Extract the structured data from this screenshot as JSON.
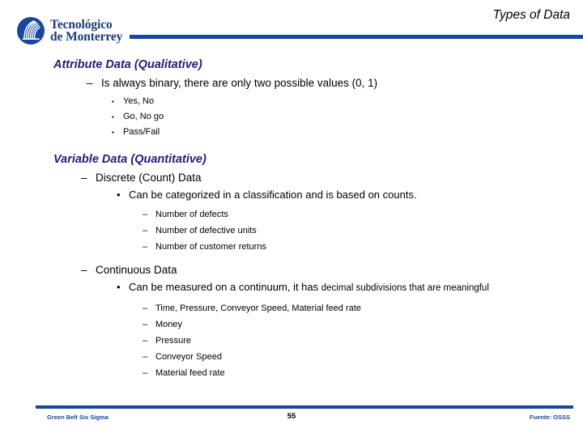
{
  "brand": {
    "emblem_icon": "tec-monterrey-emblem-icon",
    "wordmark_line1": "Tecnológico",
    "wordmark_line2": "de Monterrey",
    "navy": "#17479e",
    "heading_navy": "#21217a"
  },
  "header": {
    "title": "Types of Data"
  },
  "sections": [
    {
      "heading": "Attribute Data (Qualitative)",
      "lvl1": "Is always binary, there are only two possible values (0, 1)",
      "square_items": [
        "Yes, No",
        "Go, No go",
        "Pass/Fail"
      ]
    },
    {
      "heading": "Variable Data (Quantitative)",
      "discrete": {
        "label": "Discrete (Count) Data",
        "bullet": "Can be categorized in a classification and is based on counts.",
        "dash_items": [
          "Number of defects",
          "Number of defective units",
          "Number of customer returns"
        ]
      },
      "continuous": {
        "label": "Continuous Data",
        "bullet_main": "Can be measured on a continuum, it has ",
        "bullet_small": "decimal subdivisions that are meaningful",
        "dash_items": [
          "Time, Pressure, Conveyor Speed, Material feed rate",
          "Money",
          "Pressure",
          "Conveyor Speed",
          "Material feed rate"
        ]
      }
    }
  ],
  "markers": {
    "dash": "–",
    "round": "•",
    "square": "▪"
  },
  "footer": {
    "left": "Green Belt Six Sigma",
    "page": "55",
    "right": "Fuente: OSSS"
  }
}
